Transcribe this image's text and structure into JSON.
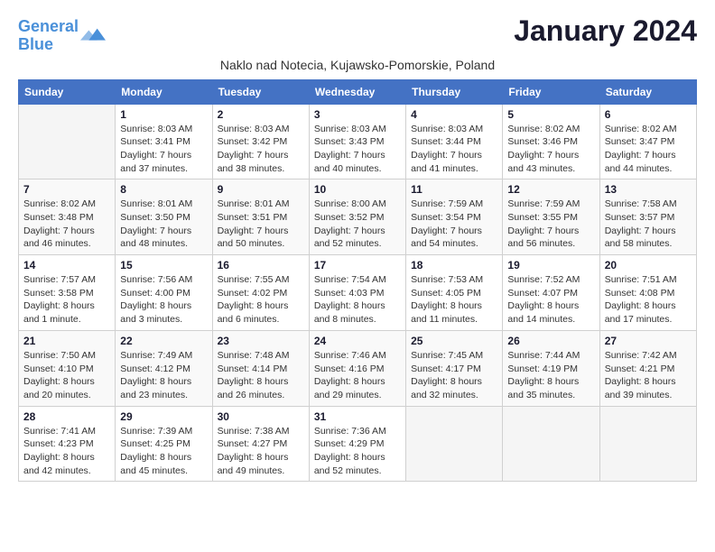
{
  "header": {
    "logo_general": "General",
    "logo_blue": "Blue",
    "month_title": "January 2024",
    "subtitle": "Naklo nad Notecia, Kujawsko-Pomorskie, Poland"
  },
  "days_of_week": [
    "Sunday",
    "Monday",
    "Tuesday",
    "Wednesday",
    "Thursday",
    "Friday",
    "Saturday"
  ],
  "weeks": [
    [
      {
        "day": "",
        "info": ""
      },
      {
        "day": "1",
        "info": "Sunrise: 8:03 AM\nSunset: 3:41 PM\nDaylight: 7 hours\nand 37 minutes."
      },
      {
        "day": "2",
        "info": "Sunrise: 8:03 AM\nSunset: 3:42 PM\nDaylight: 7 hours\nand 38 minutes."
      },
      {
        "day": "3",
        "info": "Sunrise: 8:03 AM\nSunset: 3:43 PM\nDaylight: 7 hours\nand 40 minutes."
      },
      {
        "day": "4",
        "info": "Sunrise: 8:03 AM\nSunset: 3:44 PM\nDaylight: 7 hours\nand 41 minutes."
      },
      {
        "day": "5",
        "info": "Sunrise: 8:02 AM\nSunset: 3:46 PM\nDaylight: 7 hours\nand 43 minutes."
      },
      {
        "day": "6",
        "info": "Sunrise: 8:02 AM\nSunset: 3:47 PM\nDaylight: 7 hours\nand 44 minutes."
      }
    ],
    [
      {
        "day": "7",
        "info": "Sunrise: 8:02 AM\nSunset: 3:48 PM\nDaylight: 7 hours\nand 46 minutes."
      },
      {
        "day": "8",
        "info": "Sunrise: 8:01 AM\nSunset: 3:50 PM\nDaylight: 7 hours\nand 48 minutes."
      },
      {
        "day": "9",
        "info": "Sunrise: 8:01 AM\nSunset: 3:51 PM\nDaylight: 7 hours\nand 50 minutes."
      },
      {
        "day": "10",
        "info": "Sunrise: 8:00 AM\nSunset: 3:52 PM\nDaylight: 7 hours\nand 52 minutes."
      },
      {
        "day": "11",
        "info": "Sunrise: 7:59 AM\nSunset: 3:54 PM\nDaylight: 7 hours\nand 54 minutes."
      },
      {
        "day": "12",
        "info": "Sunrise: 7:59 AM\nSunset: 3:55 PM\nDaylight: 7 hours\nand 56 minutes."
      },
      {
        "day": "13",
        "info": "Sunrise: 7:58 AM\nSunset: 3:57 PM\nDaylight: 7 hours\nand 58 minutes."
      }
    ],
    [
      {
        "day": "14",
        "info": "Sunrise: 7:57 AM\nSunset: 3:58 PM\nDaylight: 8 hours\nand 1 minute."
      },
      {
        "day": "15",
        "info": "Sunrise: 7:56 AM\nSunset: 4:00 PM\nDaylight: 8 hours\nand 3 minutes."
      },
      {
        "day": "16",
        "info": "Sunrise: 7:55 AM\nSunset: 4:02 PM\nDaylight: 8 hours\nand 6 minutes."
      },
      {
        "day": "17",
        "info": "Sunrise: 7:54 AM\nSunset: 4:03 PM\nDaylight: 8 hours\nand 8 minutes."
      },
      {
        "day": "18",
        "info": "Sunrise: 7:53 AM\nSunset: 4:05 PM\nDaylight: 8 hours\nand 11 minutes."
      },
      {
        "day": "19",
        "info": "Sunrise: 7:52 AM\nSunset: 4:07 PM\nDaylight: 8 hours\nand 14 minutes."
      },
      {
        "day": "20",
        "info": "Sunrise: 7:51 AM\nSunset: 4:08 PM\nDaylight: 8 hours\nand 17 minutes."
      }
    ],
    [
      {
        "day": "21",
        "info": "Sunrise: 7:50 AM\nSunset: 4:10 PM\nDaylight: 8 hours\nand 20 minutes."
      },
      {
        "day": "22",
        "info": "Sunrise: 7:49 AM\nSunset: 4:12 PM\nDaylight: 8 hours\nand 23 minutes."
      },
      {
        "day": "23",
        "info": "Sunrise: 7:48 AM\nSunset: 4:14 PM\nDaylight: 8 hours\nand 26 minutes."
      },
      {
        "day": "24",
        "info": "Sunrise: 7:46 AM\nSunset: 4:16 PM\nDaylight: 8 hours\nand 29 minutes."
      },
      {
        "day": "25",
        "info": "Sunrise: 7:45 AM\nSunset: 4:17 PM\nDaylight: 8 hours\nand 32 minutes."
      },
      {
        "day": "26",
        "info": "Sunrise: 7:44 AM\nSunset: 4:19 PM\nDaylight: 8 hours\nand 35 minutes."
      },
      {
        "day": "27",
        "info": "Sunrise: 7:42 AM\nSunset: 4:21 PM\nDaylight: 8 hours\nand 39 minutes."
      }
    ],
    [
      {
        "day": "28",
        "info": "Sunrise: 7:41 AM\nSunset: 4:23 PM\nDaylight: 8 hours\nand 42 minutes."
      },
      {
        "day": "29",
        "info": "Sunrise: 7:39 AM\nSunset: 4:25 PM\nDaylight: 8 hours\nand 45 minutes."
      },
      {
        "day": "30",
        "info": "Sunrise: 7:38 AM\nSunset: 4:27 PM\nDaylight: 8 hours\nand 49 minutes."
      },
      {
        "day": "31",
        "info": "Sunrise: 7:36 AM\nSunset: 4:29 PM\nDaylight: 8 hours\nand 52 minutes."
      },
      {
        "day": "",
        "info": ""
      },
      {
        "day": "",
        "info": ""
      },
      {
        "day": "",
        "info": ""
      }
    ]
  ]
}
